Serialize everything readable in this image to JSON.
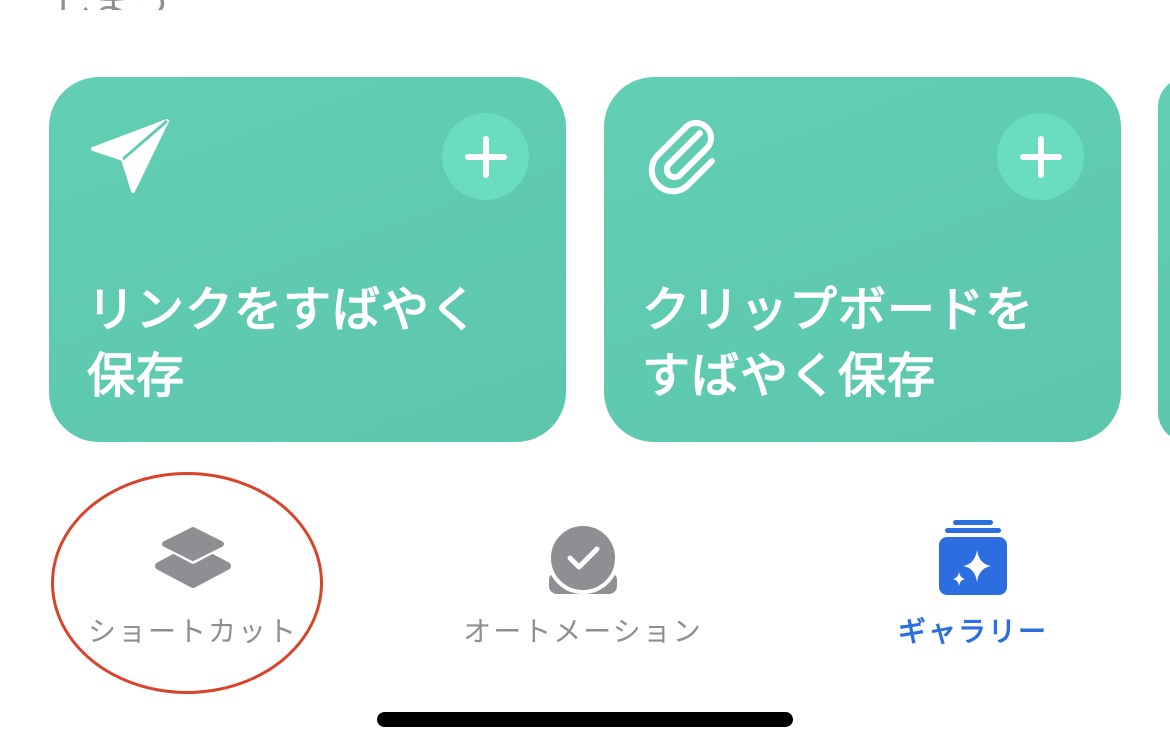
{
  "top_partial_text": "しまう",
  "cards": [
    {
      "icon": "paper-plane-icon",
      "title_line1": "リンクをすばやく",
      "title_line2": "保存"
    },
    {
      "icon": "paperclip-icon",
      "title_line1": "クリップボードを",
      "title_line2": "すばやく保存"
    }
  ],
  "tabbar": {
    "shortcuts_label": "ショートカット",
    "automation_label": "オートメーション",
    "gallery_label": "ギャラリー"
  },
  "colors": {
    "card_background": "#5fcbb2",
    "card_add_button": "#6adcc0",
    "tab_inactive": "#8e8e93",
    "tab_active": "#2c6ee0",
    "annotation": "#d9432a"
  }
}
